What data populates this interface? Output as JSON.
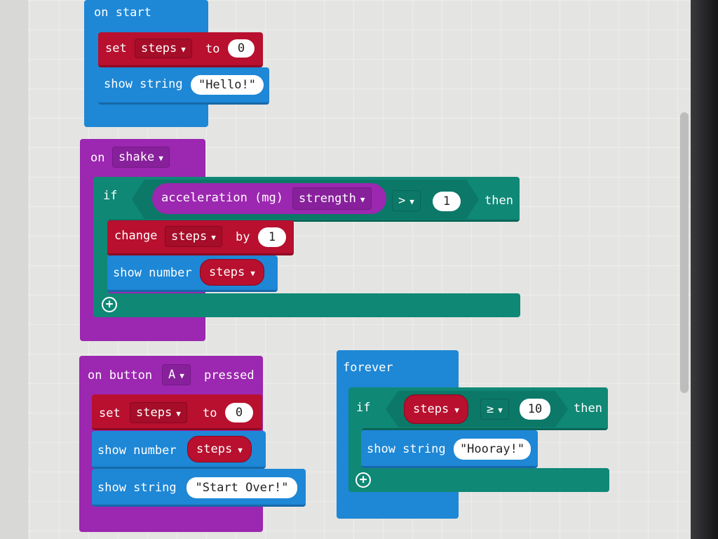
{
  "on_start": {
    "header": "on start",
    "set_label": "set",
    "set_var": "steps",
    "set_to": "to",
    "set_value": "0",
    "show_string_label": "show string",
    "show_string_value": "\"Hello!\""
  },
  "on_shake": {
    "header": "on",
    "gesture": "shake",
    "if_label": "if",
    "sensor": "acceleration (mg)",
    "dimension": "strength",
    "op": ">",
    "compare_value": "1",
    "then_label": "then",
    "change_label": "change",
    "change_var": "steps",
    "by_label": "by",
    "change_value": "1",
    "show_number_label": "show number",
    "show_number_var": "steps"
  },
  "on_button": {
    "prefix": "on button",
    "button": "A",
    "suffix": "pressed",
    "set_label": "set",
    "set_var": "steps",
    "set_to": "to",
    "set_value": "0",
    "show_number_label": "show number",
    "show_number_var": "steps",
    "show_string_label": "show string",
    "show_string_value": "\"Start Over!\""
  },
  "forever": {
    "header": "forever",
    "if_label": "if",
    "var": "steps",
    "op": "≥",
    "compare_value": "10",
    "then_label": "then",
    "show_string_label": "show string",
    "show_string_value": "\"Hooray!\""
  },
  "icons": {
    "dropdown": "triangle-down",
    "add": "plus-circle"
  },
  "colors": {
    "events_blue": "#1e87d6",
    "input_purple": "#9c27b0",
    "variables_red": "#b8102e",
    "logic_teal": "#0f8876"
  }
}
